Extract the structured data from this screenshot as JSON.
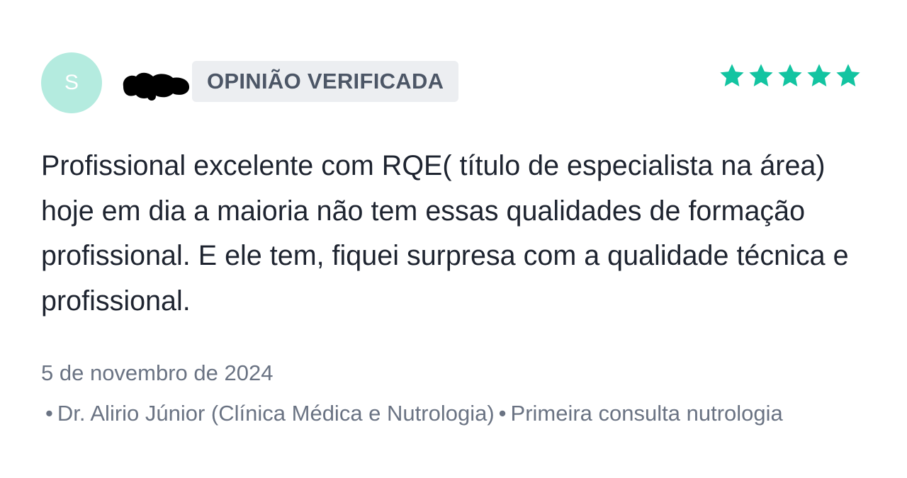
{
  "review": {
    "avatar_initial": "S",
    "badge_label": "OPINIÃO VERIFICADA",
    "rating": 5,
    "rating_max": 5,
    "star_color": "#13c4a1",
    "avatar_color": "#b4ebdf",
    "text": "Profissional excelente com RQE( título de especialista na área) hoje em dia a maioria não tem essas qualidades de formação profissional. E ele tem, fiquei surpresa com a qualidade técnica e profissional.",
    "date": "5 de novembro de 2024",
    "bullet": "•",
    "doctor": "Dr. Alirio Júnior (Clínica Médica e Nutrologia)",
    "service": "Primeira consulta nutrologia"
  }
}
